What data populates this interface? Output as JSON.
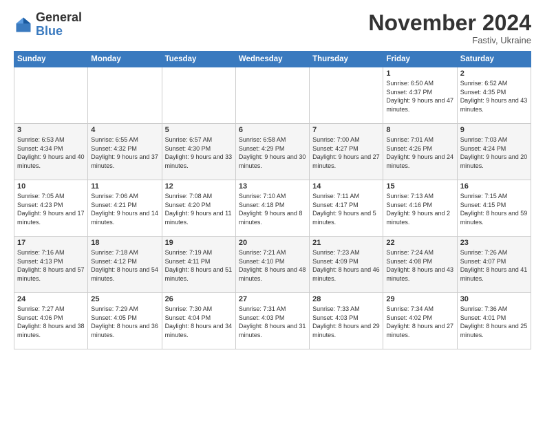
{
  "header": {
    "logo_general": "General",
    "logo_blue": "Blue",
    "month_title": "November 2024",
    "subtitle": "Fastiv, Ukraine"
  },
  "days_of_week": [
    "Sunday",
    "Monday",
    "Tuesday",
    "Wednesday",
    "Thursday",
    "Friday",
    "Saturday"
  ],
  "weeks": [
    [
      {
        "day": "",
        "sunrise": "",
        "sunset": "",
        "daylight": ""
      },
      {
        "day": "",
        "sunrise": "",
        "sunset": "",
        "daylight": ""
      },
      {
        "day": "",
        "sunrise": "",
        "sunset": "",
        "daylight": ""
      },
      {
        "day": "",
        "sunrise": "",
        "sunset": "",
        "daylight": ""
      },
      {
        "day": "",
        "sunrise": "",
        "sunset": "",
        "daylight": ""
      },
      {
        "day": "1",
        "sunrise": "Sunrise: 6:50 AM",
        "sunset": "Sunset: 4:37 PM",
        "daylight": "Daylight: 9 hours and 47 minutes."
      },
      {
        "day": "2",
        "sunrise": "Sunrise: 6:52 AM",
        "sunset": "Sunset: 4:35 PM",
        "daylight": "Daylight: 9 hours and 43 minutes."
      }
    ],
    [
      {
        "day": "3",
        "sunrise": "Sunrise: 6:53 AM",
        "sunset": "Sunset: 4:34 PM",
        "daylight": "Daylight: 9 hours and 40 minutes."
      },
      {
        "day": "4",
        "sunrise": "Sunrise: 6:55 AM",
        "sunset": "Sunset: 4:32 PM",
        "daylight": "Daylight: 9 hours and 37 minutes."
      },
      {
        "day": "5",
        "sunrise": "Sunrise: 6:57 AM",
        "sunset": "Sunset: 4:30 PM",
        "daylight": "Daylight: 9 hours and 33 minutes."
      },
      {
        "day": "6",
        "sunrise": "Sunrise: 6:58 AM",
        "sunset": "Sunset: 4:29 PM",
        "daylight": "Daylight: 9 hours and 30 minutes."
      },
      {
        "day": "7",
        "sunrise": "Sunrise: 7:00 AM",
        "sunset": "Sunset: 4:27 PM",
        "daylight": "Daylight: 9 hours and 27 minutes."
      },
      {
        "day": "8",
        "sunrise": "Sunrise: 7:01 AM",
        "sunset": "Sunset: 4:26 PM",
        "daylight": "Daylight: 9 hours and 24 minutes."
      },
      {
        "day": "9",
        "sunrise": "Sunrise: 7:03 AM",
        "sunset": "Sunset: 4:24 PM",
        "daylight": "Daylight: 9 hours and 20 minutes."
      }
    ],
    [
      {
        "day": "10",
        "sunrise": "Sunrise: 7:05 AM",
        "sunset": "Sunset: 4:23 PM",
        "daylight": "Daylight: 9 hours and 17 minutes."
      },
      {
        "day": "11",
        "sunrise": "Sunrise: 7:06 AM",
        "sunset": "Sunset: 4:21 PM",
        "daylight": "Daylight: 9 hours and 14 minutes."
      },
      {
        "day": "12",
        "sunrise": "Sunrise: 7:08 AM",
        "sunset": "Sunset: 4:20 PM",
        "daylight": "Daylight: 9 hours and 11 minutes."
      },
      {
        "day": "13",
        "sunrise": "Sunrise: 7:10 AM",
        "sunset": "Sunset: 4:18 PM",
        "daylight": "Daylight: 9 hours and 8 minutes."
      },
      {
        "day": "14",
        "sunrise": "Sunrise: 7:11 AM",
        "sunset": "Sunset: 4:17 PM",
        "daylight": "Daylight: 9 hours and 5 minutes."
      },
      {
        "day": "15",
        "sunrise": "Sunrise: 7:13 AM",
        "sunset": "Sunset: 4:16 PM",
        "daylight": "Daylight: 9 hours and 2 minutes."
      },
      {
        "day": "16",
        "sunrise": "Sunrise: 7:15 AM",
        "sunset": "Sunset: 4:15 PM",
        "daylight": "Daylight: 8 hours and 59 minutes."
      }
    ],
    [
      {
        "day": "17",
        "sunrise": "Sunrise: 7:16 AM",
        "sunset": "Sunset: 4:13 PM",
        "daylight": "Daylight: 8 hours and 57 minutes."
      },
      {
        "day": "18",
        "sunrise": "Sunrise: 7:18 AM",
        "sunset": "Sunset: 4:12 PM",
        "daylight": "Daylight: 8 hours and 54 minutes."
      },
      {
        "day": "19",
        "sunrise": "Sunrise: 7:19 AM",
        "sunset": "Sunset: 4:11 PM",
        "daylight": "Daylight: 8 hours and 51 minutes."
      },
      {
        "day": "20",
        "sunrise": "Sunrise: 7:21 AM",
        "sunset": "Sunset: 4:10 PM",
        "daylight": "Daylight: 8 hours and 48 minutes."
      },
      {
        "day": "21",
        "sunrise": "Sunrise: 7:23 AM",
        "sunset": "Sunset: 4:09 PM",
        "daylight": "Daylight: 8 hours and 46 minutes."
      },
      {
        "day": "22",
        "sunrise": "Sunrise: 7:24 AM",
        "sunset": "Sunset: 4:08 PM",
        "daylight": "Daylight: 8 hours and 43 minutes."
      },
      {
        "day": "23",
        "sunrise": "Sunrise: 7:26 AM",
        "sunset": "Sunset: 4:07 PM",
        "daylight": "Daylight: 8 hours and 41 minutes."
      }
    ],
    [
      {
        "day": "24",
        "sunrise": "Sunrise: 7:27 AM",
        "sunset": "Sunset: 4:06 PM",
        "daylight": "Daylight: 8 hours and 38 minutes."
      },
      {
        "day": "25",
        "sunrise": "Sunrise: 7:29 AM",
        "sunset": "Sunset: 4:05 PM",
        "daylight": "Daylight: 8 hours and 36 minutes."
      },
      {
        "day": "26",
        "sunrise": "Sunrise: 7:30 AM",
        "sunset": "Sunset: 4:04 PM",
        "daylight": "Daylight: 8 hours and 34 minutes."
      },
      {
        "day": "27",
        "sunrise": "Sunrise: 7:31 AM",
        "sunset": "Sunset: 4:03 PM",
        "daylight": "Daylight: 8 hours and 31 minutes."
      },
      {
        "day": "28",
        "sunrise": "Sunrise: 7:33 AM",
        "sunset": "Sunset: 4:03 PM",
        "daylight": "Daylight: 8 hours and 29 minutes."
      },
      {
        "day": "29",
        "sunrise": "Sunrise: 7:34 AM",
        "sunset": "Sunset: 4:02 PM",
        "daylight": "Daylight: 8 hours and 27 minutes."
      },
      {
        "day": "30",
        "sunrise": "Sunrise: 7:36 AM",
        "sunset": "Sunset: 4:01 PM",
        "daylight": "Daylight: 8 hours and 25 minutes."
      }
    ]
  ]
}
